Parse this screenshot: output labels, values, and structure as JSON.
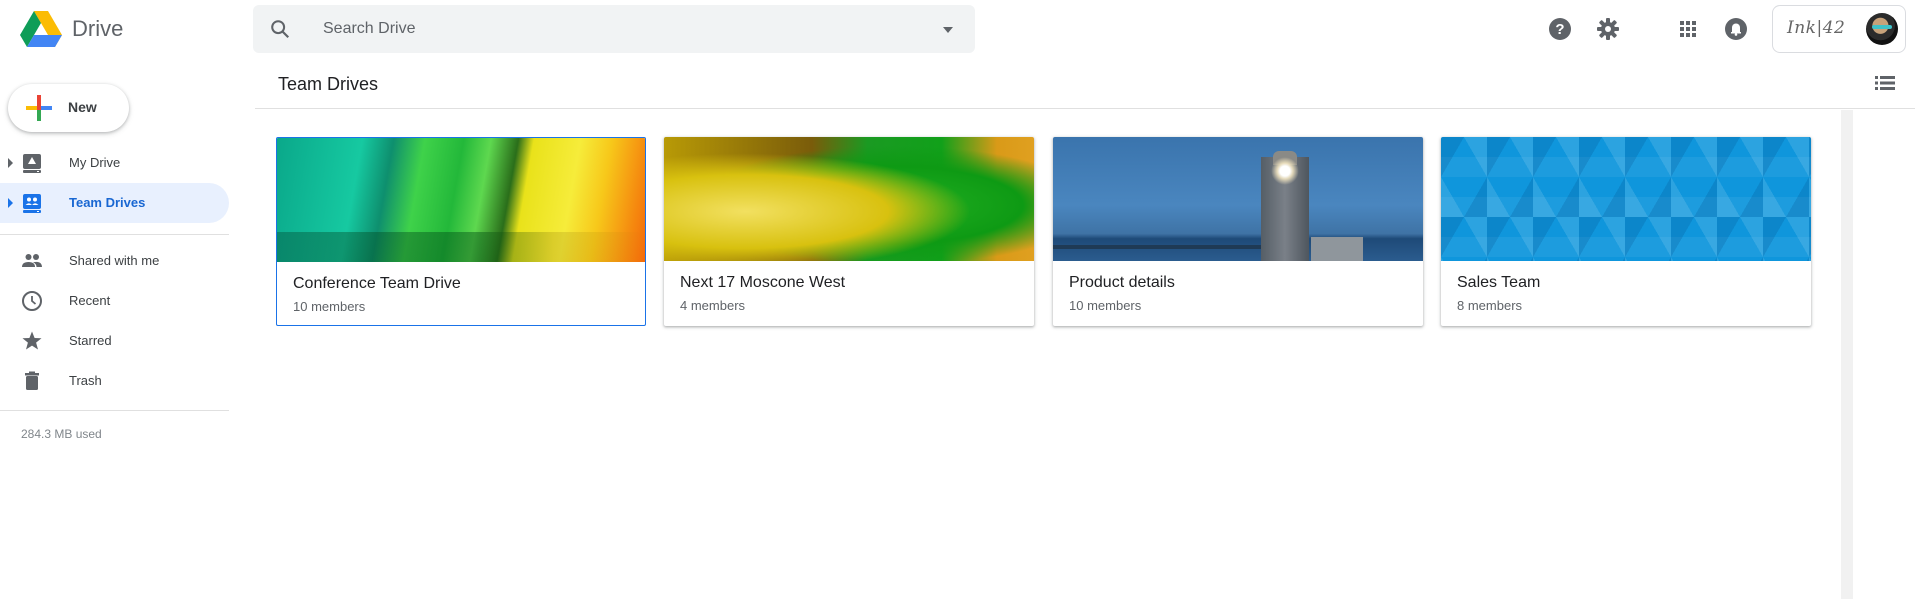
{
  "app": {
    "name": "Drive",
    "search": {
      "placeholder": "Search Drive",
      "value": ""
    },
    "account": {
      "brand_text": "Ink|42"
    }
  },
  "header_icons": [
    {
      "name": "help-icon",
      "label": "Help"
    },
    {
      "name": "settings-icon",
      "label": "Settings"
    },
    {
      "name": "apps-grid-icon",
      "label": "Apps"
    },
    {
      "name": "notifications-icon",
      "label": "Notifications"
    }
  ],
  "sidebar": {
    "new_label": "New",
    "items": [
      {
        "label": "My Drive",
        "icon": "my-drive-icon",
        "expandable": true,
        "active": false
      },
      {
        "label": "Team Drives",
        "icon": "team-drives-icon",
        "expandable": true,
        "active": true
      },
      {
        "label": "Shared with me",
        "icon": "shared-people-icon",
        "expandable": false,
        "active": false
      },
      {
        "label": "Recent",
        "icon": "clock-icon",
        "expandable": false,
        "active": false
      },
      {
        "label": "Starred",
        "icon": "star-icon",
        "expandable": false,
        "active": false
      },
      {
        "label": "Trash",
        "icon": "trash-icon",
        "expandable": false,
        "active": false
      }
    ],
    "storage_used": "284.3 MB used"
  },
  "main": {
    "title": "Team Drives",
    "view_toggle": "list-view-icon",
    "team_drives": [
      {
        "name": "Conference Team Drive",
        "members": "10 members",
        "theme": "colored pencils",
        "selected": true
      },
      {
        "name": "Next 17 Moscone West",
        "members": "4 members",
        "theme": "yellow green water",
        "selected": false
      },
      {
        "name": "Product details",
        "members": "10 members",
        "theme": "lighthouse at dusk",
        "selected": false
      },
      {
        "name": "Sales Team",
        "members": "8 members",
        "theme": "blue geometric pattern",
        "selected": false
      }
    ]
  },
  "colors": {
    "accent": "#1a73e8",
    "active_nav_bg": "#e8f0fe",
    "active_nav_text": "#1967d2",
    "search_bg": "#f1f3f4",
    "icon_grey": "#5f6368"
  }
}
